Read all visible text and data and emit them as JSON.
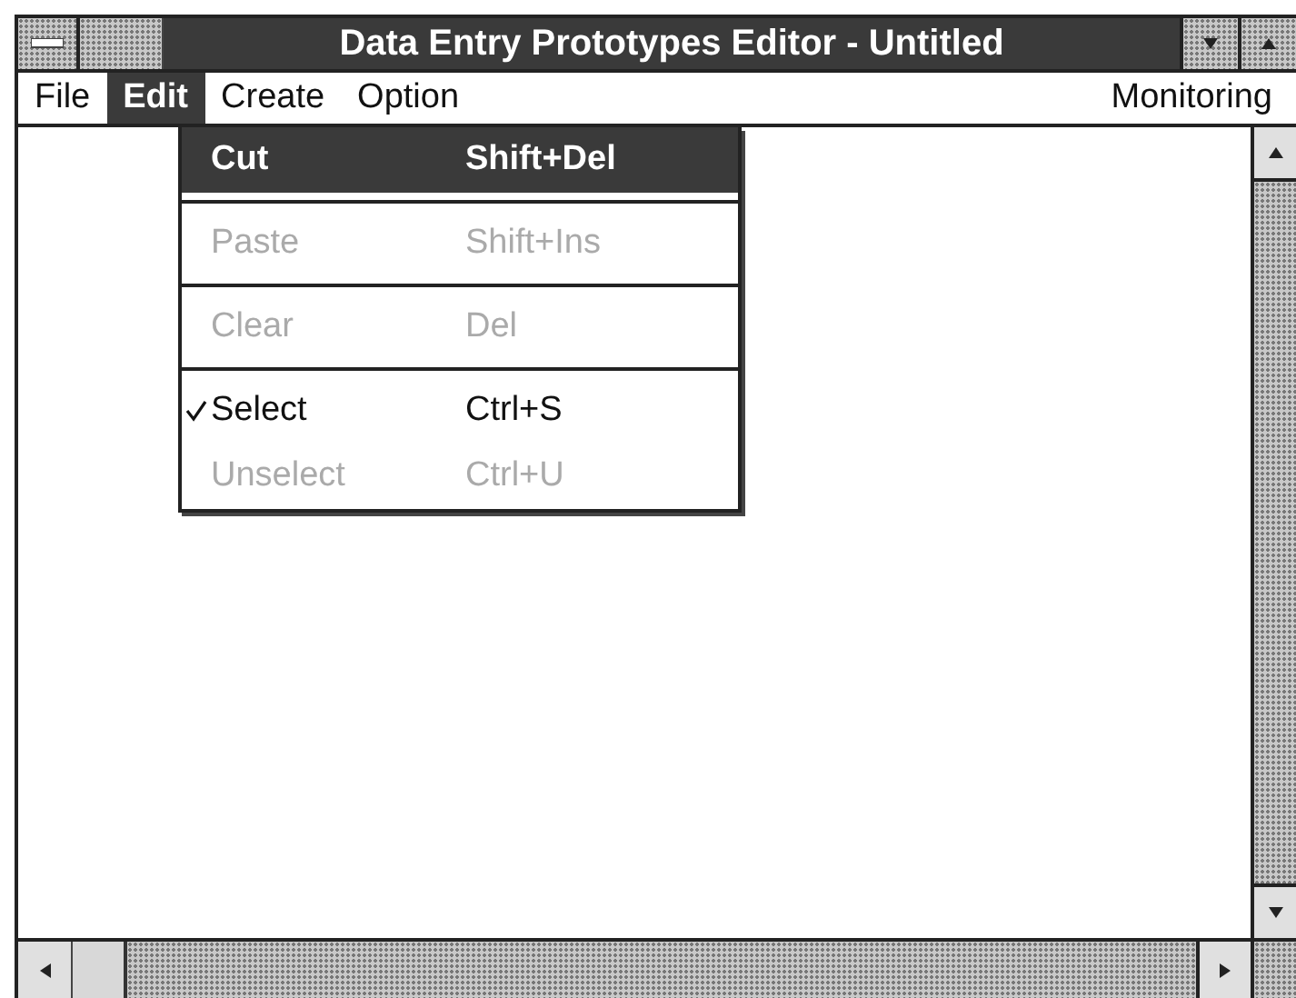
{
  "window": {
    "title": "Data Entry Prototypes Editor - Untitled"
  },
  "menu_bar": [
    {
      "label": "File",
      "selected": false
    },
    {
      "label": "Edit",
      "selected": true
    },
    {
      "label": "Create",
      "selected": false
    },
    {
      "label": "Option",
      "selected": false
    },
    {
      "label": "Monitoring",
      "selected": false
    }
  ],
  "edit_menu": [
    {
      "kind": "item",
      "label": "Cut",
      "shortcut": "Shift+Del",
      "selected": true,
      "disabled": false,
      "checked": false
    },
    {
      "kind": "separator"
    },
    {
      "kind": "item",
      "label": "Paste",
      "shortcut": "Shift+Ins",
      "selected": false,
      "disabled": true,
      "checked": false
    },
    {
      "kind": "separator"
    },
    {
      "kind": "item",
      "label": "Clear",
      "shortcut": "Del",
      "selected": false,
      "disabled": true,
      "checked": false
    },
    {
      "kind": "separator"
    },
    {
      "kind": "item",
      "label": "Select",
      "shortcut": "Ctrl+S",
      "selected": false,
      "disabled": false,
      "checked": true
    },
    {
      "kind": "item",
      "label": "Unselect",
      "shortcut": "Ctrl+U",
      "selected": false,
      "disabled": true,
      "checked": false
    }
  ]
}
